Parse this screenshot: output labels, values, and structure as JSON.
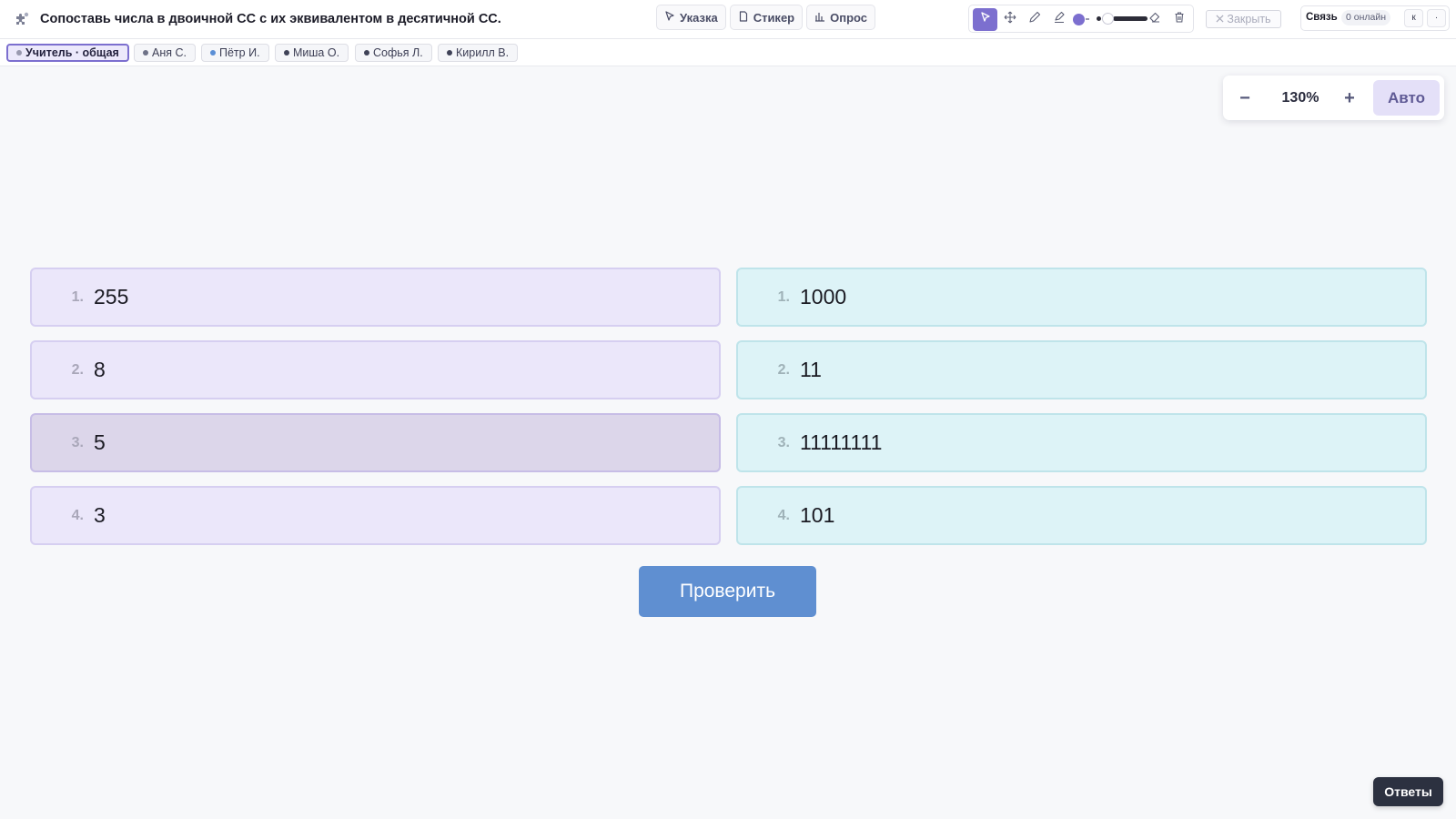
{
  "header": {
    "title": "Сопоставь числа в двоичной СС с их эквивалентом в десятичной СС.",
    "logo_icon": "puzzle-icon"
  },
  "toolbar": {
    "hint_label": "Указка",
    "sticker_label": "Стикер",
    "poll_label": "Опрос",
    "close_label": "Закрыть"
  },
  "drawing": {
    "tools": [
      "pointer-icon",
      "move-icon",
      "pencil-icon",
      "highlighter-icon",
      "eraser-icon",
      "trash-icon"
    ],
    "active_tool": "pointer-icon",
    "color": "#7c6fcf"
  },
  "connection": {
    "label": "Связь",
    "online": "0 онлайн",
    "btn1": "к",
    "btn2": "·"
  },
  "tabs": [
    {
      "label": "Учитель · общая",
      "dot": "#9a9ab0",
      "active": true
    },
    {
      "label": "Аня С.",
      "dot": "#6e7287",
      "active": false
    },
    {
      "label": "Пётр И.",
      "dot": "#5b8fd6",
      "active": false
    },
    {
      "label": "Миша О.",
      "dot": "#3f4257",
      "active": false
    },
    {
      "label": "Софья Л.",
      "dot": "#3f4257",
      "active": false
    },
    {
      "label": "Кирилл В.",
      "dot": "#3f4257",
      "active": false
    }
  ],
  "zoom": {
    "minus": "−",
    "level": "130%",
    "plus": "+",
    "auto_label": "Авто"
  },
  "left_items": [
    {
      "num": "1.",
      "text": "255"
    },
    {
      "num": "2.",
      "text": "8"
    },
    {
      "num": "3.",
      "text": "5",
      "selected": true
    },
    {
      "num": "4.",
      "text": "3"
    }
  ],
  "right_items": [
    {
      "num": "1.",
      "text": "1000"
    },
    {
      "num": "2.",
      "text": "11"
    },
    {
      "num": "3.",
      "text": "11111111"
    },
    {
      "num": "4.",
      "text": "101"
    }
  ],
  "actions": {
    "check_label": "Проверить",
    "answers_label": "Ответы"
  }
}
